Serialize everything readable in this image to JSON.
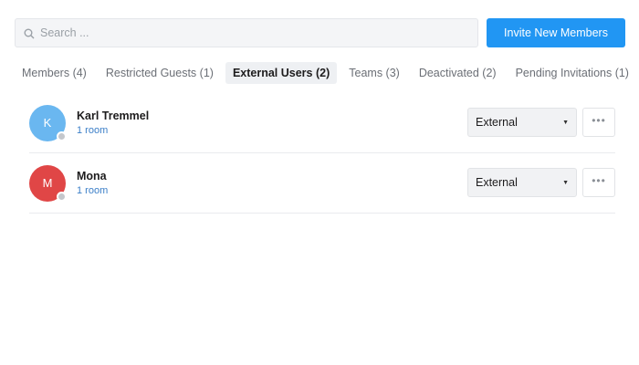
{
  "search": {
    "placeholder": "Search ...",
    "value": ""
  },
  "header": {
    "invite_label": "Invite New Members"
  },
  "tabs": [
    {
      "label": "Members (4)",
      "active": false
    },
    {
      "label": "Restricted Guests (1)",
      "active": false
    },
    {
      "label": "External Users (2)",
      "active": true
    },
    {
      "label": "Teams (3)",
      "active": false
    },
    {
      "label": "Deactivated (2)",
      "active": false
    },
    {
      "label": "Pending Invitations (1)",
      "active": false
    }
  ],
  "members": [
    {
      "initial": "K",
      "name": "Karl Tremmel",
      "rooms": "1 room",
      "role": "External",
      "avatar_color": "#6ab7f0"
    },
    {
      "initial": "M",
      "name": "Mona",
      "rooms": "1 room",
      "role": "External",
      "avatar_color": "#e04646"
    }
  ],
  "icons": {
    "search": "search-icon",
    "caret": "caret-down-icon",
    "more": "more-horizontal-icon",
    "status": "status-dot-icon"
  },
  "colors": {
    "accent": "#2196f3",
    "link": "#3c7fc8",
    "status_offline": "#c4c7cc"
  }
}
